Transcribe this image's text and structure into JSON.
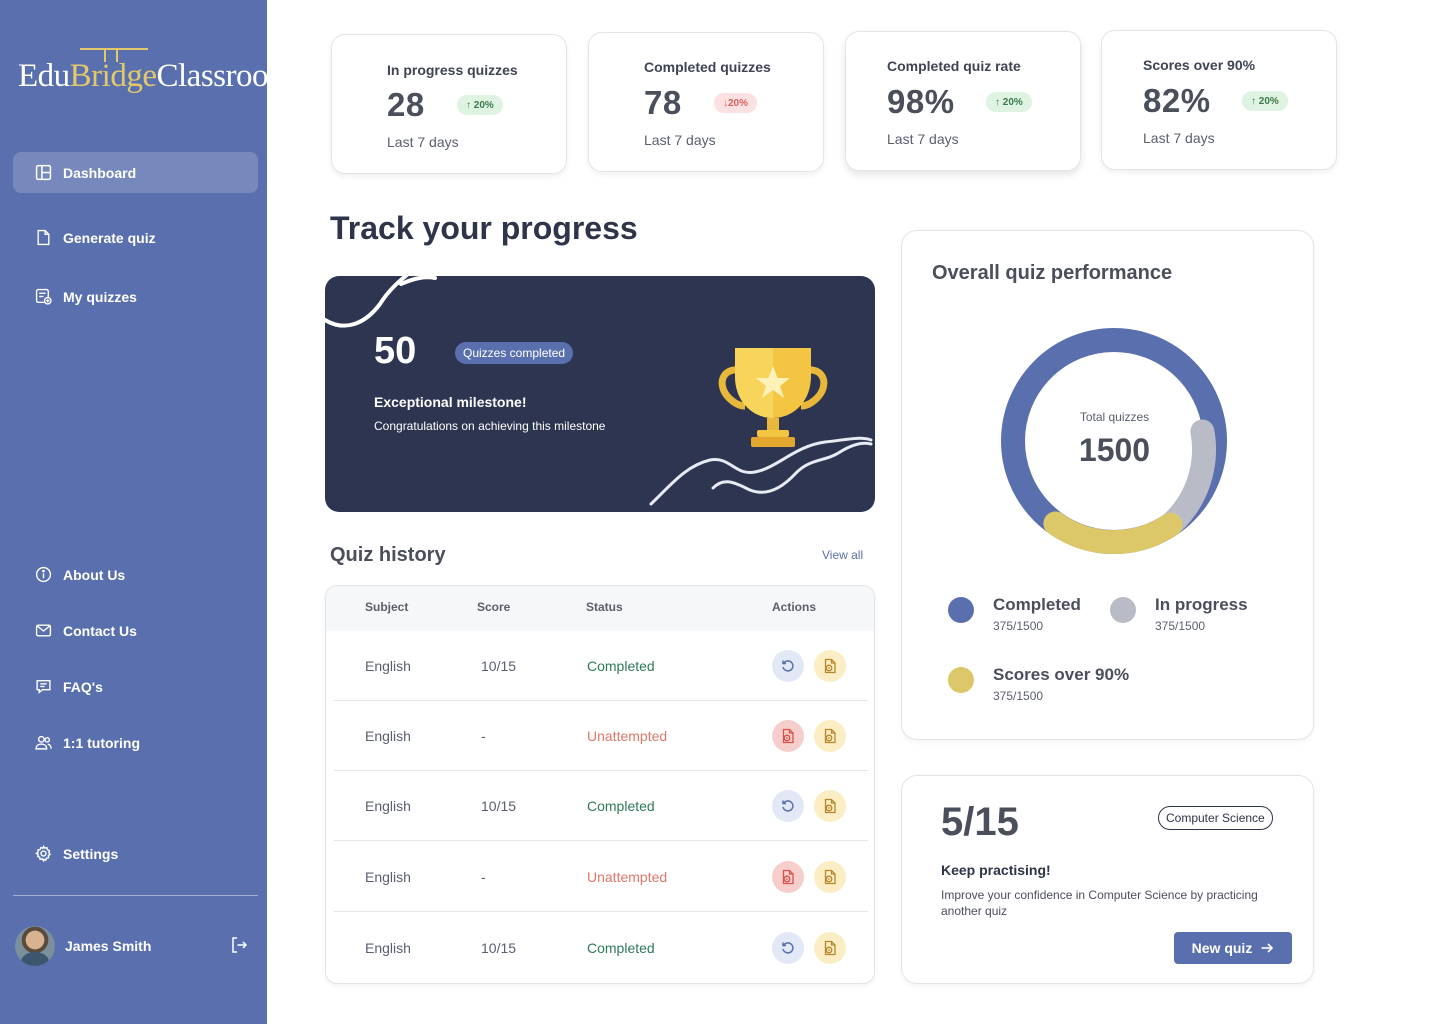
{
  "brand": {
    "part1": "Edu",
    "part2": "Bridge",
    "part3": "Classroom"
  },
  "sidebar": {
    "items": [
      {
        "label": "Dashboard",
        "icon": "dashboard-icon",
        "active": true
      },
      {
        "label": "Generate quiz",
        "icon": "file-icon"
      },
      {
        "label": "My quizzes",
        "icon": "quiz-list-icon"
      },
      {
        "label": "About Us",
        "icon": "info-icon"
      },
      {
        "label": "Contact Us",
        "icon": "mail-icon"
      },
      {
        "label": "FAQ's",
        "icon": "chat-icon"
      },
      {
        "label": "1:1 tutoring",
        "icon": "users-icon"
      },
      {
        "label": "Settings",
        "icon": "gear-icon"
      }
    ],
    "user": {
      "name": "James Smith"
    }
  },
  "stats": [
    {
      "label": "In progress quizzes",
      "value": "28",
      "change": "20%",
      "direction": "up",
      "period": "Last 7 days"
    },
    {
      "label": "Completed quizzes",
      "value": "78",
      "change": "20%",
      "direction": "down",
      "period": "Last 7 days"
    },
    {
      "label": "Completed quiz rate",
      "value": "98%",
      "change": "20%",
      "direction": "up",
      "period": "Last 7 days"
    },
    {
      "label": "Scores over 90%",
      "value": "82%",
      "change": "20%",
      "direction": "up",
      "period": "Last 7 days"
    }
  ],
  "heading": "Track your progress",
  "milestone": {
    "count": "50",
    "pill": "Quizzes completed",
    "title": "Exceptional milestone!",
    "message": "Congratulations on achieving this milestone"
  },
  "history": {
    "title": "Quiz history",
    "view_all": "View all",
    "columns": [
      "Subject",
      "Score",
      "Status",
      "Actions"
    ],
    "rows": [
      {
        "subject": "English",
        "score": "10/15",
        "status": "Completed"
      },
      {
        "subject": "English",
        "score": "-",
        "status": "Unattempted"
      },
      {
        "subject": "English",
        "score": "10/15",
        "status": "Completed"
      },
      {
        "subject": "English",
        "score": "-",
        "status": "Unattempted"
      },
      {
        "subject": "English",
        "score": "10/15",
        "status": "Completed"
      }
    ]
  },
  "performance": {
    "title": "Overall quiz performance",
    "center_label": "Total quizzes",
    "center_value": "1500",
    "legend": [
      {
        "name": "Completed",
        "value": "375/1500",
        "color": "#5a70ae"
      },
      {
        "name": "In progress",
        "value": "375/1500",
        "color": "#b9bcc7"
      },
      {
        "name": "Scores over 90%",
        "value": "375/1500",
        "color": "#dcc868"
      }
    ]
  },
  "practice": {
    "score": "5/15",
    "tag": "Computer Science",
    "title": "Keep practising!",
    "message": "Improve your confidence in Computer Science by practicing another quiz",
    "button": "New quiz"
  },
  "colors": {
    "sidebar": "#5a70ae",
    "dark_card": "#2e3550",
    "completed": "#2f7a58",
    "unattempted": "#e0776b",
    "gold": "#dcc868"
  }
}
